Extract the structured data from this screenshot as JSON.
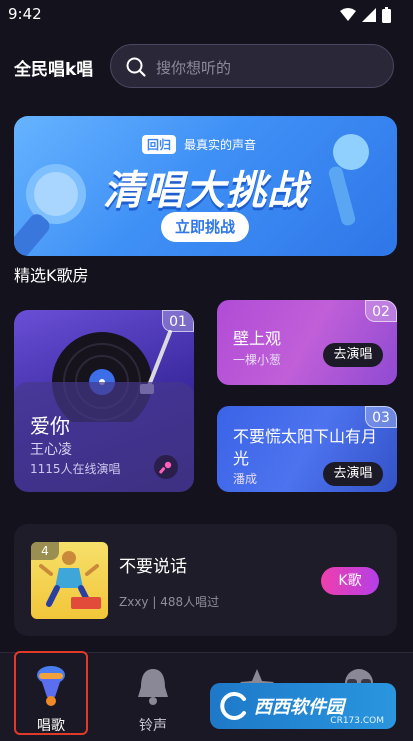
{
  "status_bar": {
    "time": "9:42"
  },
  "header": {
    "app_title": "全民唱k唱",
    "search_placeholder": "搜你想听的"
  },
  "banner": {
    "tag": "回归",
    "subtitle": "最真实的声音",
    "title": "清唱大挑战",
    "button": "立即挑战"
  },
  "section": {
    "title": "精选K歌房"
  },
  "featured": {
    "rank": "01",
    "song": "爱你",
    "singer": "王心凌",
    "online": "1115人在线演唱"
  },
  "cards": [
    {
      "rank": "02",
      "title": "壁上观",
      "subtitle": "一棵小葱",
      "button": "去演唱"
    },
    {
      "rank": "03",
      "title": "不要慌太阳下山有月光",
      "subtitle": "潘成",
      "button": "去演唱"
    }
  ],
  "list_item": {
    "rank": "4",
    "title": "不要说话",
    "meta": "Zxxy | 488人唱过",
    "button": "K歌"
  },
  "nav": {
    "items": [
      {
        "label": "唱歌",
        "active": true
      },
      {
        "label": "铃声",
        "active": false
      }
    ]
  },
  "watermark": {
    "text": "西西软件园",
    "sub": "CR173.COM"
  },
  "colors": {
    "banner": "#3f90f6",
    "accent_pink": "#ef3fae",
    "background": "#14121c"
  }
}
